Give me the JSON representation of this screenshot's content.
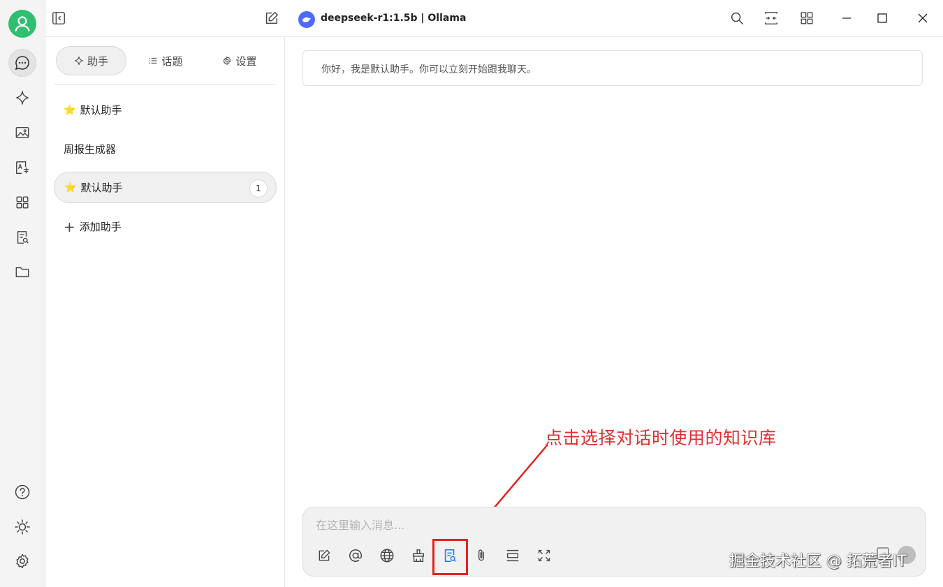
{
  "window": {
    "model_title": "deepseek-r1:1.5b | Ollama"
  },
  "sidebar": {
    "tabs": [
      {
        "label": "助手",
        "icon": "sparkle-icon"
      },
      {
        "label": "话题",
        "icon": "list-icon"
      },
      {
        "label": "设置",
        "icon": "gear-icon"
      }
    ],
    "items": [
      {
        "label": "默认助手",
        "emoji": "⭐"
      },
      {
        "label": "周报生成器",
        "emoji": ""
      },
      {
        "label": "默认助手",
        "emoji": "⭐",
        "count": "1"
      },
      {
        "label": "添加助手",
        "prefix": "+"
      }
    ]
  },
  "main": {
    "greeting": "你好，我是默认助手。你可以立刻开始跟我聊天。",
    "input_placeholder": "在这里输入消息..."
  },
  "annotation": {
    "text": "点击选择对话时使用的知识库",
    "color": "#e0302e"
  },
  "watermark": "掘金技术社区 @ 拓荒者IT",
  "colors": {
    "avatar": "#2fbf71",
    "model_logo": "#4d6bfe",
    "highlight": "#e3231f"
  }
}
